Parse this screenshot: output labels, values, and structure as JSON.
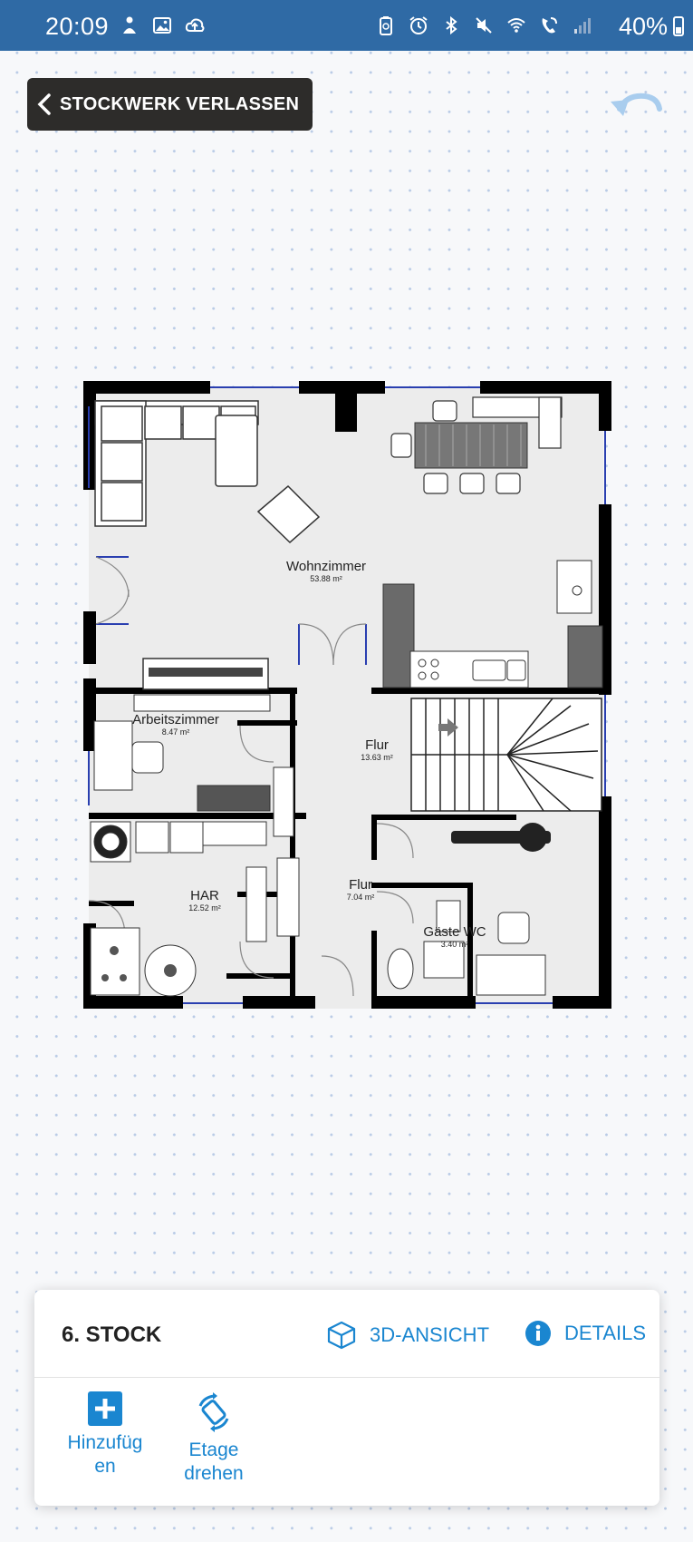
{
  "status_bar": {
    "time": "20:09",
    "battery": "40%",
    "left_icons": [
      "person-icon",
      "image-icon",
      "cloud-upload-icon"
    ],
    "right_icons": [
      "recycle-battery-icon",
      "alarm-icon",
      "bluetooth-icon",
      "mute-icon",
      "wifi-icon",
      "wifi-calling-icon",
      "signal-icon"
    ]
  },
  "header": {
    "leave_label": "STOCKWERK VERLASSEN"
  },
  "floorplan": {
    "rooms": [
      {
        "name": "Wohnzimmer",
        "area": "53.88 m²"
      },
      {
        "name": "Arbeitszimmer",
        "area": "8.47 m²"
      },
      {
        "name": "Flur",
        "area": "13.63 m²"
      },
      {
        "name": "HAR",
        "area": "12.52 m²"
      },
      {
        "name": "Flur",
        "area": "7.04 m²"
      },
      {
        "name": "Gäste WC",
        "area": "3.40 m²"
      }
    ]
  },
  "panel": {
    "title": "6. STOCK",
    "view3d_label": "3D-ANSICHT",
    "details_label": "DETAILS",
    "add_label": "Hinzufüg\nen",
    "rotate_label": "Etage\ndrehen"
  },
  "colors": {
    "status_bar": "#2f6aa5",
    "accent": "#1a86d0",
    "button_dark": "#2d2c2a",
    "wall": "#000000",
    "floor": "#ececec"
  }
}
